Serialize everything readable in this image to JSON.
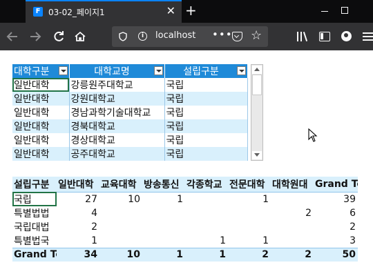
{
  "browser": {
    "tab_title": "03-02_페이지1",
    "favicon_letter": "F",
    "tab_close": "✕",
    "new_tab": "+",
    "url": "localhost",
    "page_actions": "•••"
  },
  "list_table": {
    "headers": [
      "대학구분",
      "대학교명",
      "설립구분"
    ],
    "rows": [
      [
        "일반대학",
        "강릉원주대학교",
        "국립"
      ],
      [
        "일반대학",
        "강원대학교",
        "국립"
      ],
      [
        "일반대학",
        "경남과학기술대학교",
        "국립"
      ],
      [
        "일반대학",
        "경북대학교",
        "국립"
      ],
      [
        "일반대학",
        "경상대학교",
        "국립"
      ],
      [
        "일반대학",
        "공주대학교",
        "국립"
      ]
    ]
  },
  "pivot_table": {
    "headers": [
      "설립구분",
      "일반대학",
      "교육대학",
      "방송통신",
      "각종학교",
      "전문대학",
      "대학원대",
      "Grand Total"
    ],
    "rows": [
      [
        "국립",
        "27",
        "10",
        "1",
        "",
        "1",
        "",
        "39"
      ],
      [
        "특별법법",
        "4",
        "",
        "",
        "",
        "",
        "2",
        "6"
      ],
      [
        "국립대법",
        "2",
        "",
        "",
        "",
        "",
        "",
        "2"
      ],
      [
        "특별법국",
        "1",
        "",
        "",
        "1",
        "1",
        "",
        "3"
      ]
    ],
    "total": [
      "Grand Total",
      "34",
      "10",
      "1",
      "1",
      "2",
      "2",
      "50"
    ]
  },
  "colors": {
    "header_blue": "#1f8ad8",
    "band_light_blue": "#d9f0fc",
    "selection_green": "#217346"
  }
}
